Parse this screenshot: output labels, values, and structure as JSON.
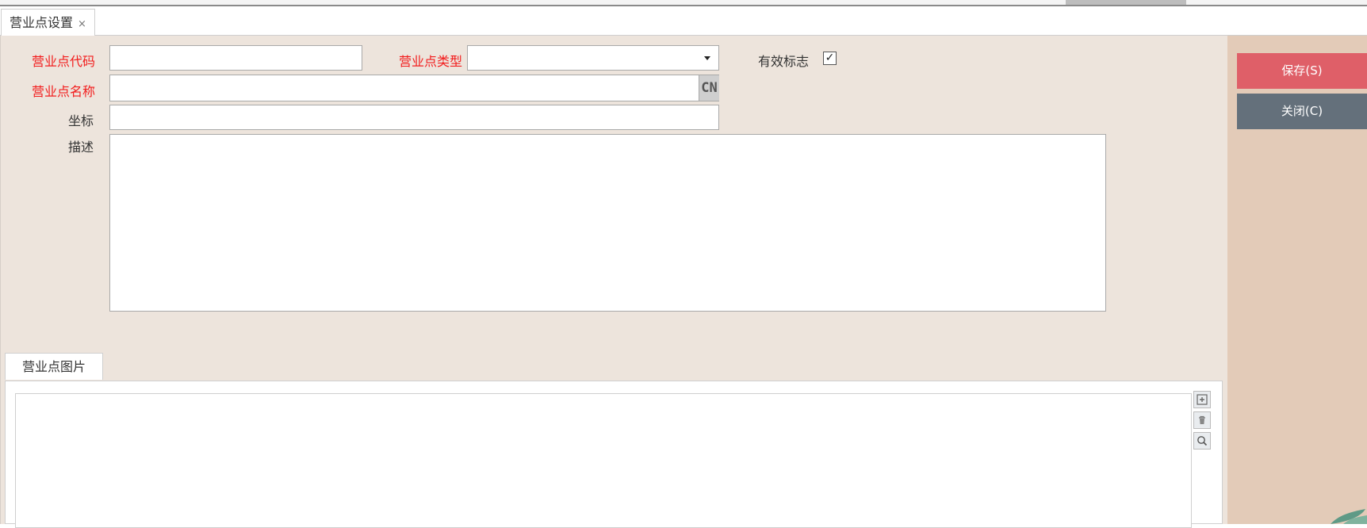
{
  "tab": {
    "title": "营业点设置",
    "close": "×"
  },
  "form": {
    "code_label": "营业点代码",
    "code_value": "",
    "type_label": "营业点类型",
    "type_value": "",
    "valid_label": "有效标志",
    "valid_checked": true,
    "valid_mark": "✓",
    "name_label": "营业点名称",
    "name_value": "",
    "cn_label": "CN",
    "coord_label": "坐标",
    "coord_value": "",
    "desc_label": "描述",
    "desc_value": ""
  },
  "images": {
    "tab_label": "营业点图片",
    "icons": [
      "plus-icon",
      "trash-icon",
      "search-icon"
    ]
  },
  "actions": {
    "save_label": "保存(S)",
    "close_label": "关闭(C)"
  },
  "colors": {
    "required_label": "#f21c1c",
    "save_button": "#df5f68",
    "close_button": "#64707b",
    "form_bg": "#ede4dc",
    "side_bg": "#e3cbb8"
  }
}
